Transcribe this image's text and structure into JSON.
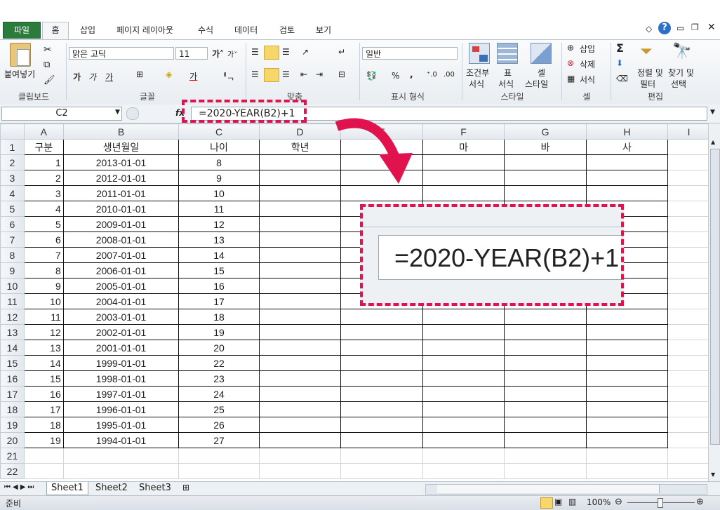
{
  "tabs": [
    "파일",
    "홈",
    "삽입",
    "페이지 레이아웃",
    "수식",
    "데이터",
    "검토",
    "보기"
  ],
  "ribbon": {
    "clipboard": {
      "paste": "붙여넣기",
      "label": "클립보드"
    },
    "font": {
      "name": "맑은 고딕",
      "size": "11",
      "label": "글꼴"
    },
    "align": {
      "label": "맞춤"
    },
    "number": {
      "format": "일반",
      "percent": "%",
      "comma": ",",
      "label": "표시 형식"
    },
    "styles": {
      "cond1": "조건부",
      "cond2": "서식",
      "table1": "표",
      "table2": "서식",
      "cell1": "셀",
      "cell2": "스타일",
      "label": "스타일"
    },
    "cells": {
      "insert": "삽입",
      "delete": "삭제",
      "format": "서식",
      "label": "셀"
    },
    "edit": {
      "sigma": "Σ",
      "sort1": "정렬 및",
      "sort2": "필터",
      "find1": "찾기 및",
      "find2": "선택",
      "label": "편집"
    }
  },
  "formula_bar": {
    "name_box": "C2",
    "fx": "fx",
    "formula": "=2020-YEAR(B2)+1"
  },
  "grid": {
    "columns": [
      "A",
      "B",
      "C",
      "D",
      "E",
      "F",
      "G",
      "H",
      "I"
    ],
    "header_row": [
      "구분",
      "생년월일",
      "나이",
      "학년",
      "",
      "마",
      "바",
      "사"
    ],
    "rows": [
      [
        "1",
        "2013-01-01",
        "8"
      ],
      [
        "2",
        "2012-01-01",
        "9"
      ],
      [
        "3",
        "2011-01-01",
        "10"
      ],
      [
        "4",
        "2010-01-01",
        "11"
      ],
      [
        "5",
        "2009-01-01",
        "12"
      ],
      [
        "6",
        "2008-01-01",
        "13"
      ],
      [
        "7",
        "2007-01-01",
        "14"
      ],
      [
        "8",
        "2006-01-01",
        "15"
      ],
      [
        "9",
        "2005-01-01",
        "16"
      ],
      [
        "10",
        "2004-01-01",
        "17"
      ],
      [
        "11",
        "2003-01-01",
        "18"
      ],
      [
        "12",
        "2002-01-01",
        "19"
      ],
      [
        "13",
        "2001-01-01",
        "20"
      ],
      [
        "14",
        "1999-01-01",
        "22"
      ],
      [
        "15",
        "1998-01-01",
        "23"
      ],
      [
        "16",
        "1997-01-01",
        "24"
      ],
      [
        "17",
        "1996-01-01",
        "25"
      ],
      [
        "18",
        "1995-01-01",
        "26"
      ],
      [
        "19",
        "1994-01-01",
        "27"
      ]
    ],
    "row_numbers": [
      "1",
      "2",
      "3",
      "4",
      "5",
      "6",
      "7",
      "8",
      "9",
      "10",
      "11",
      "12",
      "13",
      "14",
      "15",
      "16",
      "17",
      "18",
      "19",
      "20",
      "21",
      "22"
    ]
  },
  "sheets": [
    "Sheet1",
    "Sheet2",
    "Sheet3"
  ],
  "status": {
    "ready": "준비",
    "zoom": "100%"
  },
  "callout": {
    "formula": "=2020-YEAR(B2)+1"
  },
  "colors": {
    "file_tab": "#2a7c3c",
    "highlight": "#e0134f"
  }
}
